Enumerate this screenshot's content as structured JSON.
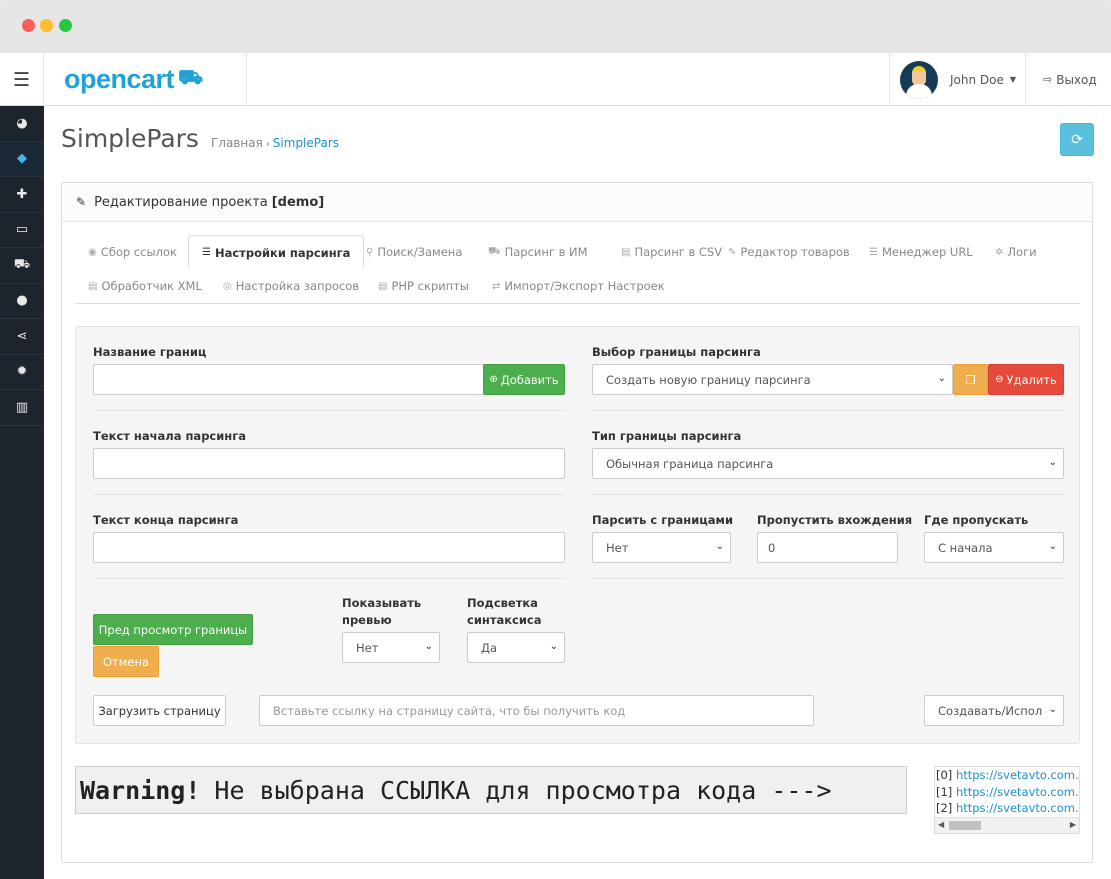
{
  "window": {
    "controls": [
      "close",
      "minimize",
      "maximize"
    ]
  },
  "header": {
    "menu_icon": "hamburger-icon",
    "logo_text": "opencart",
    "user_name": "John Doe",
    "logout_label": "Выход"
  },
  "sidebar": {
    "items": [
      {
        "icon": "dashboard-icon",
        "glyph": "◕"
      },
      {
        "icon": "tags-icon",
        "glyph": "◆",
        "active": true
      },
      {
        "icon": "puzzle-icon",
        "glyph": "✚"
      },
      {
        "icon": "desktop-icon",
        "glyph": "▭"
      },
      {
        "icon": "cart-icon",
        "glyph": "⛟"
      },
      {
        "icon": "user-icon",
        "glyph": "●"
      },
      {
        "icon": "share-icon",
        "glyph": "⋖"
      },
      {
        "icon": "cog-icon",
        "glyph": "✹"
      },
      {
        "icon": "bar-chart-icon",
        "glyph": "▥"
      }
    ]
  },
  "page": {
    "title": "SimplePars",
    "breadcrumb_home": "Главная",
    "breadcrumb_current": "SimplePars"
  },
  "panel": {
    "heading": "Редактирование проекта",
    "project": "[demo]"
  },
  "tabs": [
    {
      "label": "Сбор ссылок",
      "icon": "eye-icon"
    },
    {
      "label": "Настройки парсинга",
      "icon": "list-icon",
      "active": true
    },
    {
      "label": "Поиск/Замена",
      "icon": "search-icon"
    },
    {
      "label": "Парсинг в ИМ",
      "icon": "cart-icon"
    },
    {
      "label": "Парсинг в CSV",
      "icon": "file-icon"
    },
    {
      "label": "Редактор товаров",
      "icon": "pencil-icon"
    },
    {
      "label": "Менеджер URL",
      "icon": "list-icon"
    },
    {
      "label": "Логи",
      "icon": "bug-icon"
    },
    {
      "label": "Обработчик XML",
      "icon": "file-code-icon"
    },
    {
      "label": "Настройка запросов",
      "icon": "chrome-icon"
    },
    {
      "label": "PHP скрипты",
      "icon": "file-code-icon"
    },
    {
      "label": "Импорт/Экспорт Настроек",
      "icon": "exchange-icon"
    }
  ],
  "form": {
    "boundary_name_label": "Название границ",
    "boundary_name_value": "",
    "add_button": "Добавить",
    "boundary_select_label": "Выбор границы парсинга",
    "boundary_select_value": "Создать новую границу парсинга",
    "delete_button": "Удалить",
    "start_text_label": "Текст начала парсинга",
    "start_text_value": "",
    "boundary_type_label": "Тип границы парсинга",
    "boundary_type_value": "Обычная граница парсинга",
    "end_text_label": "Текст конца парсинга",
    "end_text_value": "",
    "parse_with_bounds_label": "Парсить с границами",
    "parse_with_bounds_value": "Нет",
    "skip_entries_label": "Пропустить вхождения",
    "skip_entries_value": "0",
    "skip_where_label": "Где пропускать",
    "skip_where_value": "С начала",
    "preview_button": "Пред просмотр границы",
    "cancel_button": "Отмена",
    "show_preview_label": "Показывать превью",
    "show_preview_value": "Нет",
    "syntax_label": "Подсветка синтаксиса",
    "syntax_value": "Да",
    "load_page_button": "Загрузить страницу",
    "url_placeholder": "Вставьте ссылку на страницу сайта, что бы получить код",
    "mode_value": "Создавать/Испол"
  },
  "warning": {
    "strong": "Warning!",
    "text": "Не выбрана ССЫЛКА для просмотра кода --->"
  },
  "link_list": [
    {
      "index": "[0]",
      "url": "https://svetavto.com.ua/"
    },
    {
      "index": "[1]",
      "url": "https://svetavto.com.ua/"
    },
    {
      "index": "[2]",
      "url": "https://svetavto.com.ua/"
    }
  ],
  "colors": {
    "brand": "#1fa3d6",
    "sidebar_bg": "#1d242c",
    "success": "#4cae4c",
    "warning": "#f0ad4e",
    "danger": "#e64a3b",
    "info": "#5bc0de",
    "link": "#1e91cf"
  }
}
